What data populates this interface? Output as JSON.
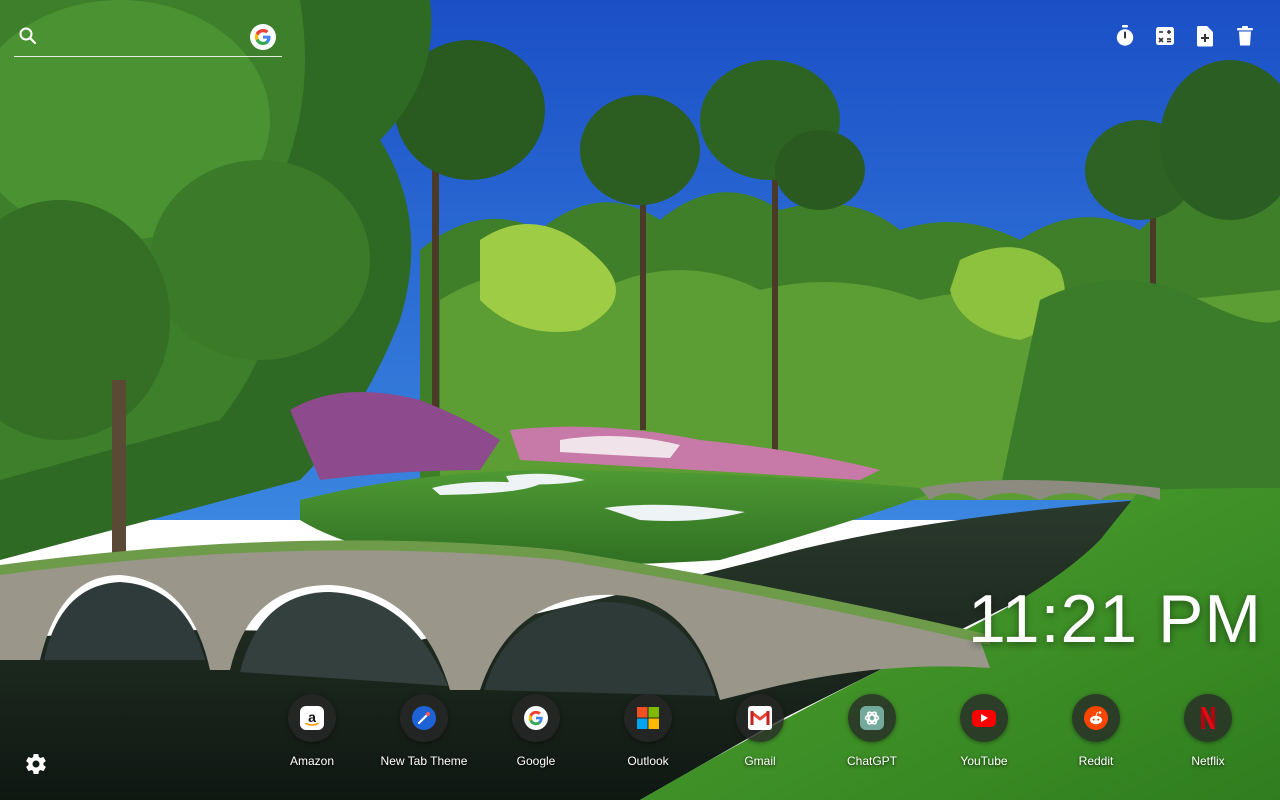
{
  "search": {
    "placeholder": "",
    "engine_icon": "google-g-icon"
  },
  "toolbar": {
    "items": [
      {
        "icon": "stopwatch-icon"
      },
      {
        "icon": "calculator-icon"
      },
      {
        "icon": "add-note-icon"
      },
      {
        "icon": "trash-icon"
      }
    ]
  },
  "clock": {
    "time": "11:21 PM"
  },
  "shortcuts": [
    {
      "label": "Amazon",
      "icon": "amazon-icon"
    },
    {
      "label": "New Tab Theme",
      "icon": "new-tab-theme-icon"
    },
    {
      "label": "Google",
      "icon": "google-icon"
    },
    {
      "label": "Outlook",
      "icon": "outlook-icon"
    },
    {
      "label": "Gmail",
      "icon": "gmail-icon"
    },
    {
      "label": "ChatGPT",
      "icon": "chatgpt-icon"
    },
    {
      "label": "YouTube",
      "icon": "youtube-icon"
    },
    {
      "label": "Reddit",
      "icon": "reddit-icon"
    },
    {
      "label": "Netflix",
      "icon": "netflix-icon"
    }
  ],
  "settings": {
    "icon": "gear-icon"
  },
  "colors": {
    "sky": "#1f5fcf",
    "grass": "#3f9a2a",
    "water": "#1f2a22",
    "text": "#ffffff"
  }
}
